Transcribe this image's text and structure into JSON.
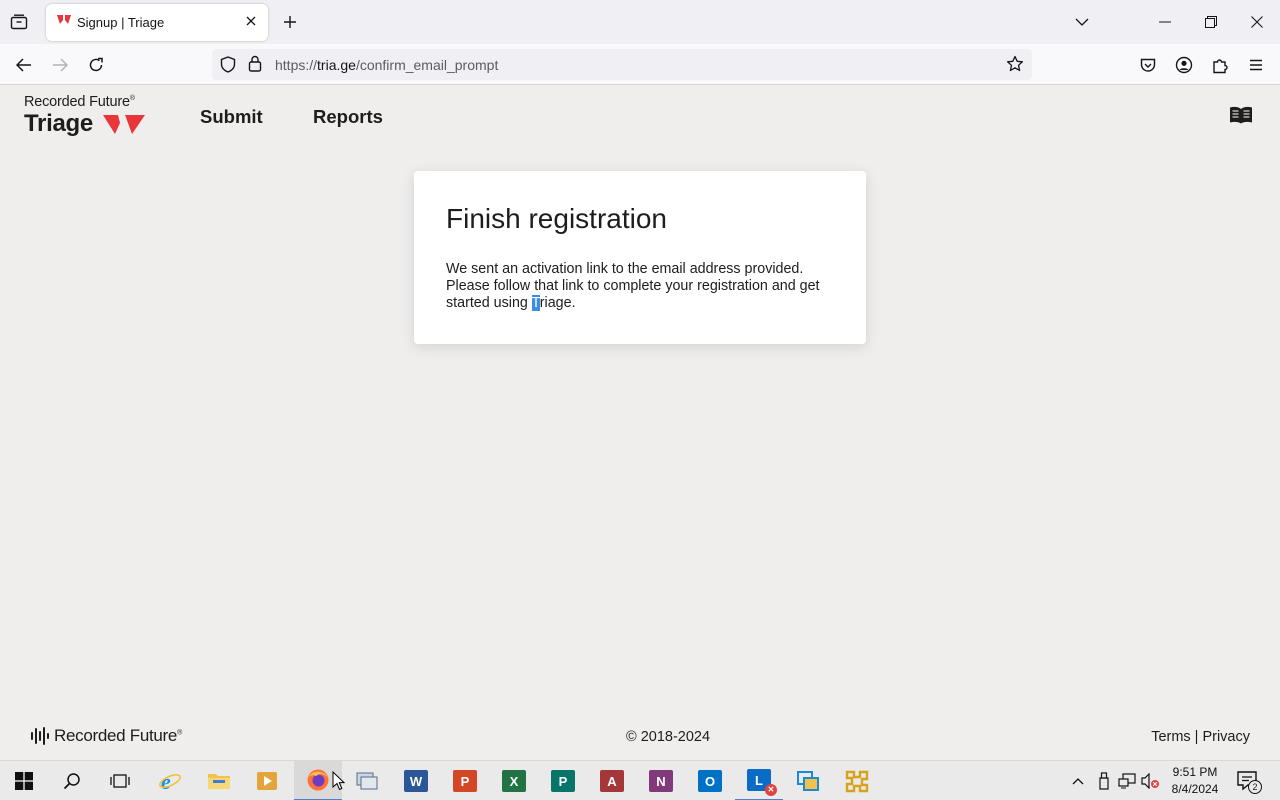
{
  "browser": {
    "tab_title": "Signup | Triage",
    "url_prefix": "https://",
    "url_host": "tria.ge",
    "url_path": "/confirm_email_prompt"
  },
  "header": {
    "brand_top": "Recorded Future",
    "brand_registered": "®",
    "brand_name": "Triage",
    "nav": {
      "submit": "Submit",
      "reports": "Reports"
    }
  },
  "card": {
    "title": "Finish registration",
    "message_before": "We sent an activation link to the email address provided. Please follow that link to complete your registration and get started using ",
    "message_selected": "T",
    "message_after": "riage."
  },
  "footer": {
    "brand": "Recorded Future",
    "brand_registered": "®",
    "copyright": "© 2018-2024",
    "terms": "Terms",
    "separator": "|",
    "privacy": "Privacy"
  },
  "taskbar": {
    "time": "9:51 PM",
    "date": "8/4/2024",
    "notification_count": "2"
  },
  "colors": {
    "brand_red": "#e8363b",
    "page_bg": "#efeeed",
    "selection": "#3b8ee0"
  }
}
